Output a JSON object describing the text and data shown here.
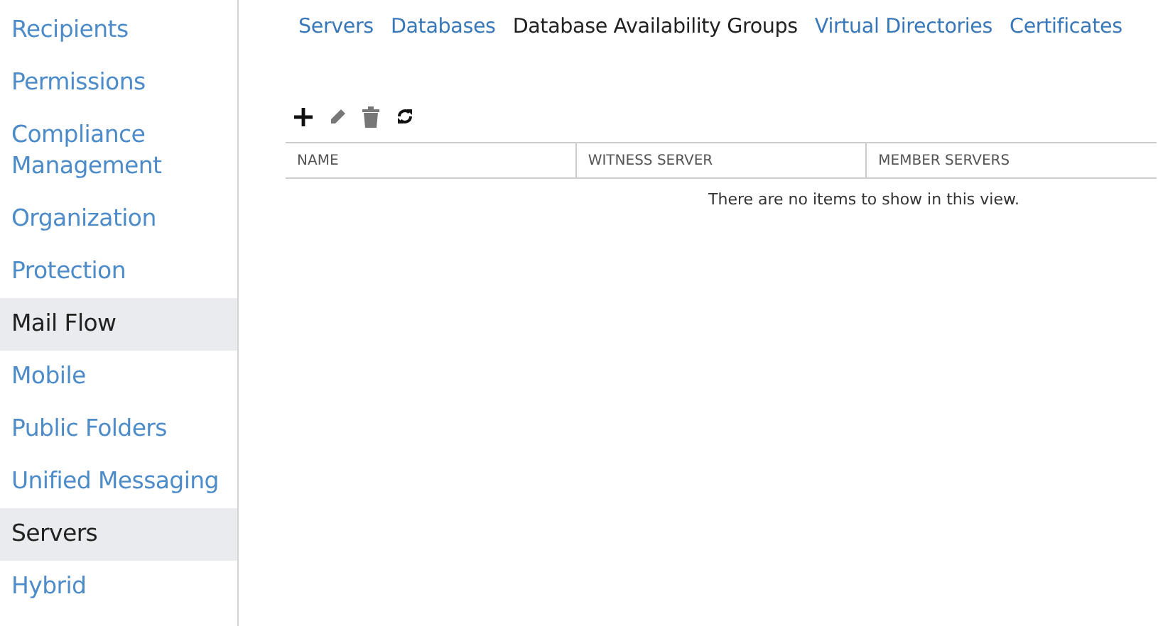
{
  "sidebar": {
    "items": [
      {
        "label": "Recipients",
        "selected": false
      },
      {
        "label": "Permissions",
        "selected": false
      },
      {
        "label": "Compliance Management",
        "selected": false
      },
      {
        "label": "Organization",
        "selected": false
      },
      {
        "label": "Protection",
        "selected": false
      },
      {
        "label": "Mail Flow",
        "selected": true
      },
      {
        "label": "Mobile",
        "selected": false
      },
      {
        "label": "Public Folders",
        "selected": false
      },
      {
        "label": "Unified Messaging",
        "selected": false
      },
      {
        "label": "Servers",
        "selected": true
      },
      {
        "label": "Hybrid",
        "selected": false
      }
    ]
  },
  "tabs": [
    {
      "label": "Servers",
      "selected": false
    },
    {
      "label": "Databases",
      "selected": false
    },
    {
      "label": "Database Availability Groups",
      "selected": true
    },
    {
      "label": "Virtual Directories",
      "selected": false
    },
    {
      "label": "Certificates",
      "selected": false
    }
  ],
  "toolbar": [
    {
      "kind": "add",
      "disabled": false
    },
    {
      "kind": "edit",
      "disabled": true
    },
    {
      "kind": "delete",
      "disabled": true
    },
    {
      "kind": "refresh",
      "disabled": false
    }
  ],
  "table": {
    "columns": [
      "NAME",
      "WITNESS SERVER",
      "MEMBER SERVERS"
    ],
    "empty_message": "There are no items to show in this view."
  }
}
